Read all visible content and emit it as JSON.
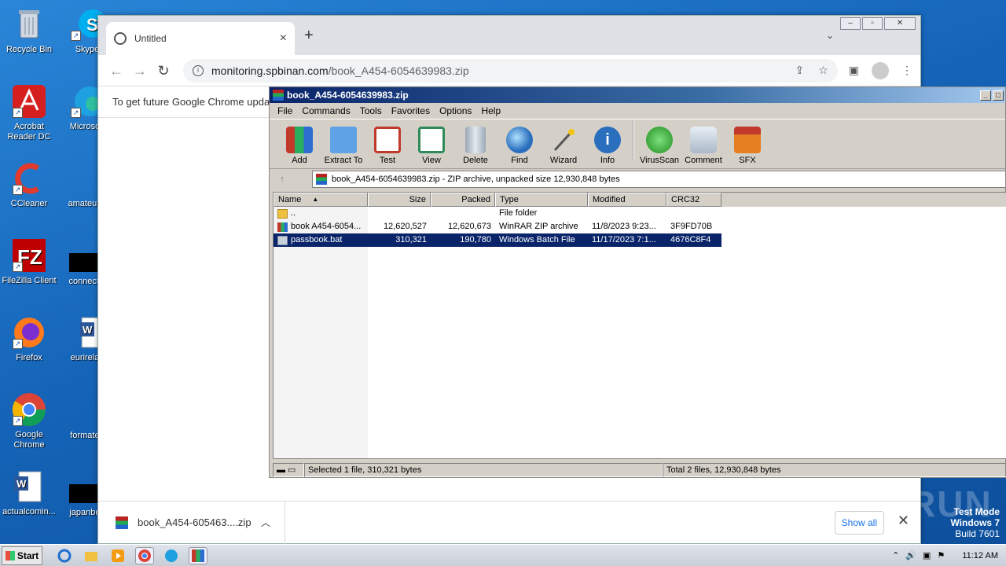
{
  "desktop": {
    "icons": [
      {
        "label": "Recycle Bin",
        "icon": "recycle-bin-icon"
      },
      {
        "label": "Skype",
        "icon": "skype-icon"
      },
      {
        "label": "Acrobat Reader DC",
        "icon": "acrobat-icon"
      },
      {
        "label": "Microsoft",
        "icon": "edge-icon"
      },
      {
        "label": "CCleaner",
        "icon": "ccleaner-icon"
      },
      {
        "label": "amateurlo",
        "icon": "file-icon"
      },
      {
        "label": "FileZilla Client",
        "icon": "filezilla-icon"
      },
      {
        "label": "connectio",
        "icon": "file-icon"
      },
      {
        "label": "Firefox",
        "icon": "firefox-icon"
      },
      {
        "label": "eurirelan",
        "icon": "word-icon"
      },
      {
        "label": "Google Chrome",
        "icon": "chrome-icon"
      },
      {
        "label": "formaten",
        "icon": "file-icon"
      },
      {
        "label": "actualcomin...",
        "icon": "word-icon"
      },
      {
        "label": "japanbett",
        "icon": "file-icon"
      }
    ],
    "watermark": {
      "line1": "Test Mode",
      "line2": "Windows 7",
      "line3": "Build 7601"
    },
    "anyrun": "ANY RUN"
  },
  "chrome": {
    "tab_title": "Untitled",
    "url_host": "monitoring.spbinan.com",
    "url_path": "/book_A454-6054639983.zip",
    "infobar_text": "To get future Google Chrome updat",
    "download_name": "book_A454-605463....zip",
    "show_all": "Show all"
  },
  "winrar": {
    "title": "book_A454-6054639983.zip",
    "menu": [
      "File",
      "Commands",
      "Tools",
      "Favorites",
      "Options",
      "Help"
    ],
    "tools": [
      {
        "label": "Add",
        "icon": "add-archive-icon",
        "color": "#c0392b"
      },
      {
        "label": "Extract To",
        "icon": "extract-folder-icon",
        "color": "#4a90d9"
      },
      {
        "label": "Test",
        "icon": "test-clipboard-icon",
        "color": "#c0392b"
      },
      {
        "label": "View",
        "icon": "view-book-icon",
        "color": "#2e8b57"
      },
      {
        "label": "Delete",
        "icon": "delete-trash-icon",
        "color": "#8a9aa8"
      },
      {
        "label": "Find",
        "icon": "find-magnifier-icon",
        "color": "#2a6fbd"
      },
      {
        "label": "Wizard",
        "icon": "wizard-wand-icon",
        "color": "#6a8f5a"
      },
      {
        "label": "Info",
        "icon": "info-icon",
        "color": "#2a6fbd"
      },
      {
        "label": "VirusScan",
        "icon": "virus-scan-icon",
        "color": "#2aa52a"
      },
      {
        "label": "Comment",
        "icon": "comment-icon",
        "color": "#7f8fa6"
      },
      {
        "label": "SFX",
        "icon": "sfx-icon",
        "color": "#d35400"
      }
    ],
    "address": "book_A454-6054639983.zip - ZIP archive, unpacked size 12,930,848 bytes",
    "columns": [
      "Name",
      "Size",
      "Packed",
      "Type",
      "Modified",
      "CRC32"
    ],
    "rows": [
      {
        "name": "..",
        "size": "",
        "packed": "",
        "type": "File folder",
        "modified": "",
        "crc": "",
        "icon": "folder-icon"
      },
      {
        "name": "book A454-6054...",
        "size": "12,620,527",
        "packed": "12,620,673",
        "type": "WinRAR ZIP archive",
        "modified": "11/8/2023 9:23...",
        "crc": "3F9FD70B",
        "icon": "zip-archive-icon"
      },
      {
        "name": "passbook.bat",
        "size": "310,321",
        "packed": "190,780",
        "type": "Windows Batch File",
        "modified": "11/17/2023 7:1...",
        "crc": "4676C8F4",
        "icon": "batch-file-icon"
      }
    ],
    "status_left": "Selected 1 file, 310,321 bytes",
    "status_right": "Total 2 files, 12,930,848 bytes"
  },
  "taskbar": {
    "start": "Start",
    "clock": "11:12 AM"
  }
}
